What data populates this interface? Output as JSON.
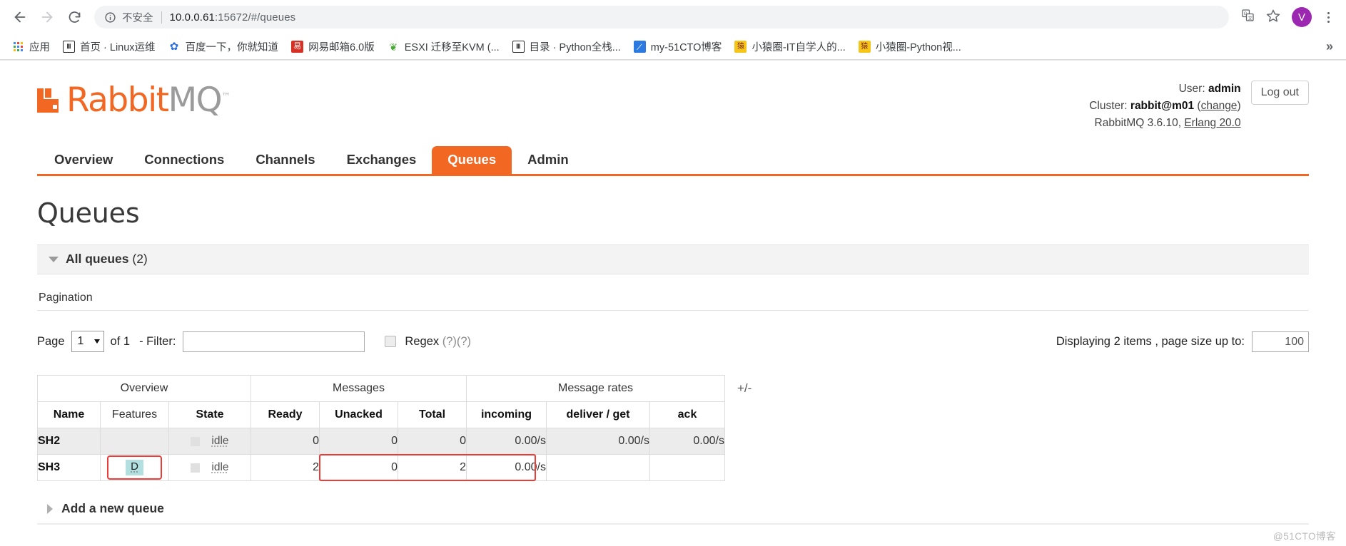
{
  "browser": {
    "back_icon": "back-arrow-icon",
    "forward_icon": "forward-arrow-icon",
    "reload_icon": "reload-icon",
    "security_label": "不安全",
    "url_host": "10.0.0.61",
    "url_path": ":15672/#/queues",
    "translate_icon": "translate-icon",
    "bookmark_star_icon": "star-icon",
    "avatar_letter": "V",
    "menu_icon": "kebab-menu-icon",
    "bookmarks_overflow": "»",
    "bookmarks": [
      {
        "label": "应用",
        "icon": "apps-grid-icon",
        "glyph": "",
        "bg": "",
        "fg": ""
      },
      {
        "label": "首页 · Linux运维",
        "icon": "book-icon",
        "glyph": "Ⅱ",
        "bg": "#ffffff",
        "fg": "#2b2b2b"
      },
      {
        "label": "百度一下，你就知道",
        "icon": "baidu-paw-icon",
        "glyph": "✿",
        "bg": "#ffffff",
        "fg": "#2b6ed9"
      },
      {
        "label": "网易邮箱6.0版",
        "icon": "netease-mail-icon",
        "glyph": "易",
        "bg": "#d93025",
        "fg": "#ffffff"
      },
      {
        "label": "ESXI 迁移至KVM (...",
        "icon": "frog-icon",
        "glyph": "❦",
        "bg": "#ffffff",
        "fg": "#46a832"
      },
      {
        "label": "目录 · Python全栈...",
        "icon": "book-icon",
        "glyph": "Ⅱ",
        "bg": "#ffffff",
        "fg": "#2b2b2b"
      },
      {
        "label": "my-51CTO博客",
        "icon": "pen-icon",
        "glyph": "╱",
        "bg": "#2a7ae2",
        "fg": "#ffffff"
      },
      {
        "label": "小猿圈-IT自学人的...",
        "icon": "monkey-icon",
        "glyph": "猿",
        "bg": "#f5c518",
        "fg": "#7a1f1f"
      },
      {
        "label": "小猿圈-Python视...",
        "icon": "monkey-icon",
        "glyph": "猿",
        "bg": "#f5c518",
        "fg": "#7a1f1f"
      }
    ]
  },
  "header": {
    "logo_rabbit": "Rabbit",
    "logo_mq": "MQ",
    "logo_tm": "™",
    "user_prefix": "User:",
    "user_name": "admin",
    "cluster_prefix": "Cluster:",
    "cluster_name": "rabbit@m01",
    "cluster_change": "change",
    "version_text": "RabbitMQ 3.6.10,",
    "erlang_text": "Erlang 20.0",
    "logout_label": "Log out"
  },
  "nav": {
    "tabs": [
      {
        "label": "Overview",
        "active": false
      },
      {
        "label": "Connections",
        "active": false
      },
      {
        "label": "Channels",
        "active": false
      },
      {
        "label": "Exchanges",
        "active": false
      },
      {
        "label": "Queues",
        "active": true
      },
      {
        "label": "Admin",
        "active": false
      }
    ]
  },
  "main": {
    "page_title": "Queues",
    "section_title": "All queues",
    "section_count": "(2)",
    "pagination_label": "Pagination",
    "page_word": "Page",
    "page_value": "1",
    "of_text": "of 1",
    "filter_label": "- Filter:",
    "filter_value": "",
    "filter_placeholder": "",
    "regex_label": "Regex",
    "regex_help": "(?)(?)",
    "regex_checked": false,
    "displaying_text": "Displaying 2 items , page size up to:",
    "page_size_value": "100",
    "plus_minus": "+/-",
    "add_queue_label": "Add a new queue",
    "watermark": "@51CTO博客"
  },
  "table": {
    "group_headers": [
      {
        "label": "Overview",
        "span": 3
      },
      {
        "label": "Messages",
        "span": 3
      },
      {
        "label": "Message rates",
        "span": 3
      }
    ],
    "columns": [
      "Name",
      "Features",
      "State",
      "Ready",
      "Unacked",
      "Total",
      "incoming",
      "deliver / get",
      "ack"
    ],
    "rows": [
      {
        "name": "SH2",
        "features": "",
        "state": "idle",
        "ready": "0",
        "unacked": "0",
        "total": "0",
        "incoming": "0.00/s",
        "deliver_get": "0.00/s",
        "ack": "0.00/s"
      },
      {
        "name": "SH3",
        "features": "D",
        "state": "idle",
        "ready": "2",
        "unacked": "0",
        "total": "2",
        "incoming": "0.00/s",
        "deliver_get": "",
        "ack": ""
      }
    ]
  },
  "colors": {
    "brand_orange": "#f26722",
    "highlight_red": "#ef3b36",
    "feature_badge_bg": "#b2e0e0",
    "avatar_purple": "#9c27b0"
  }
}
